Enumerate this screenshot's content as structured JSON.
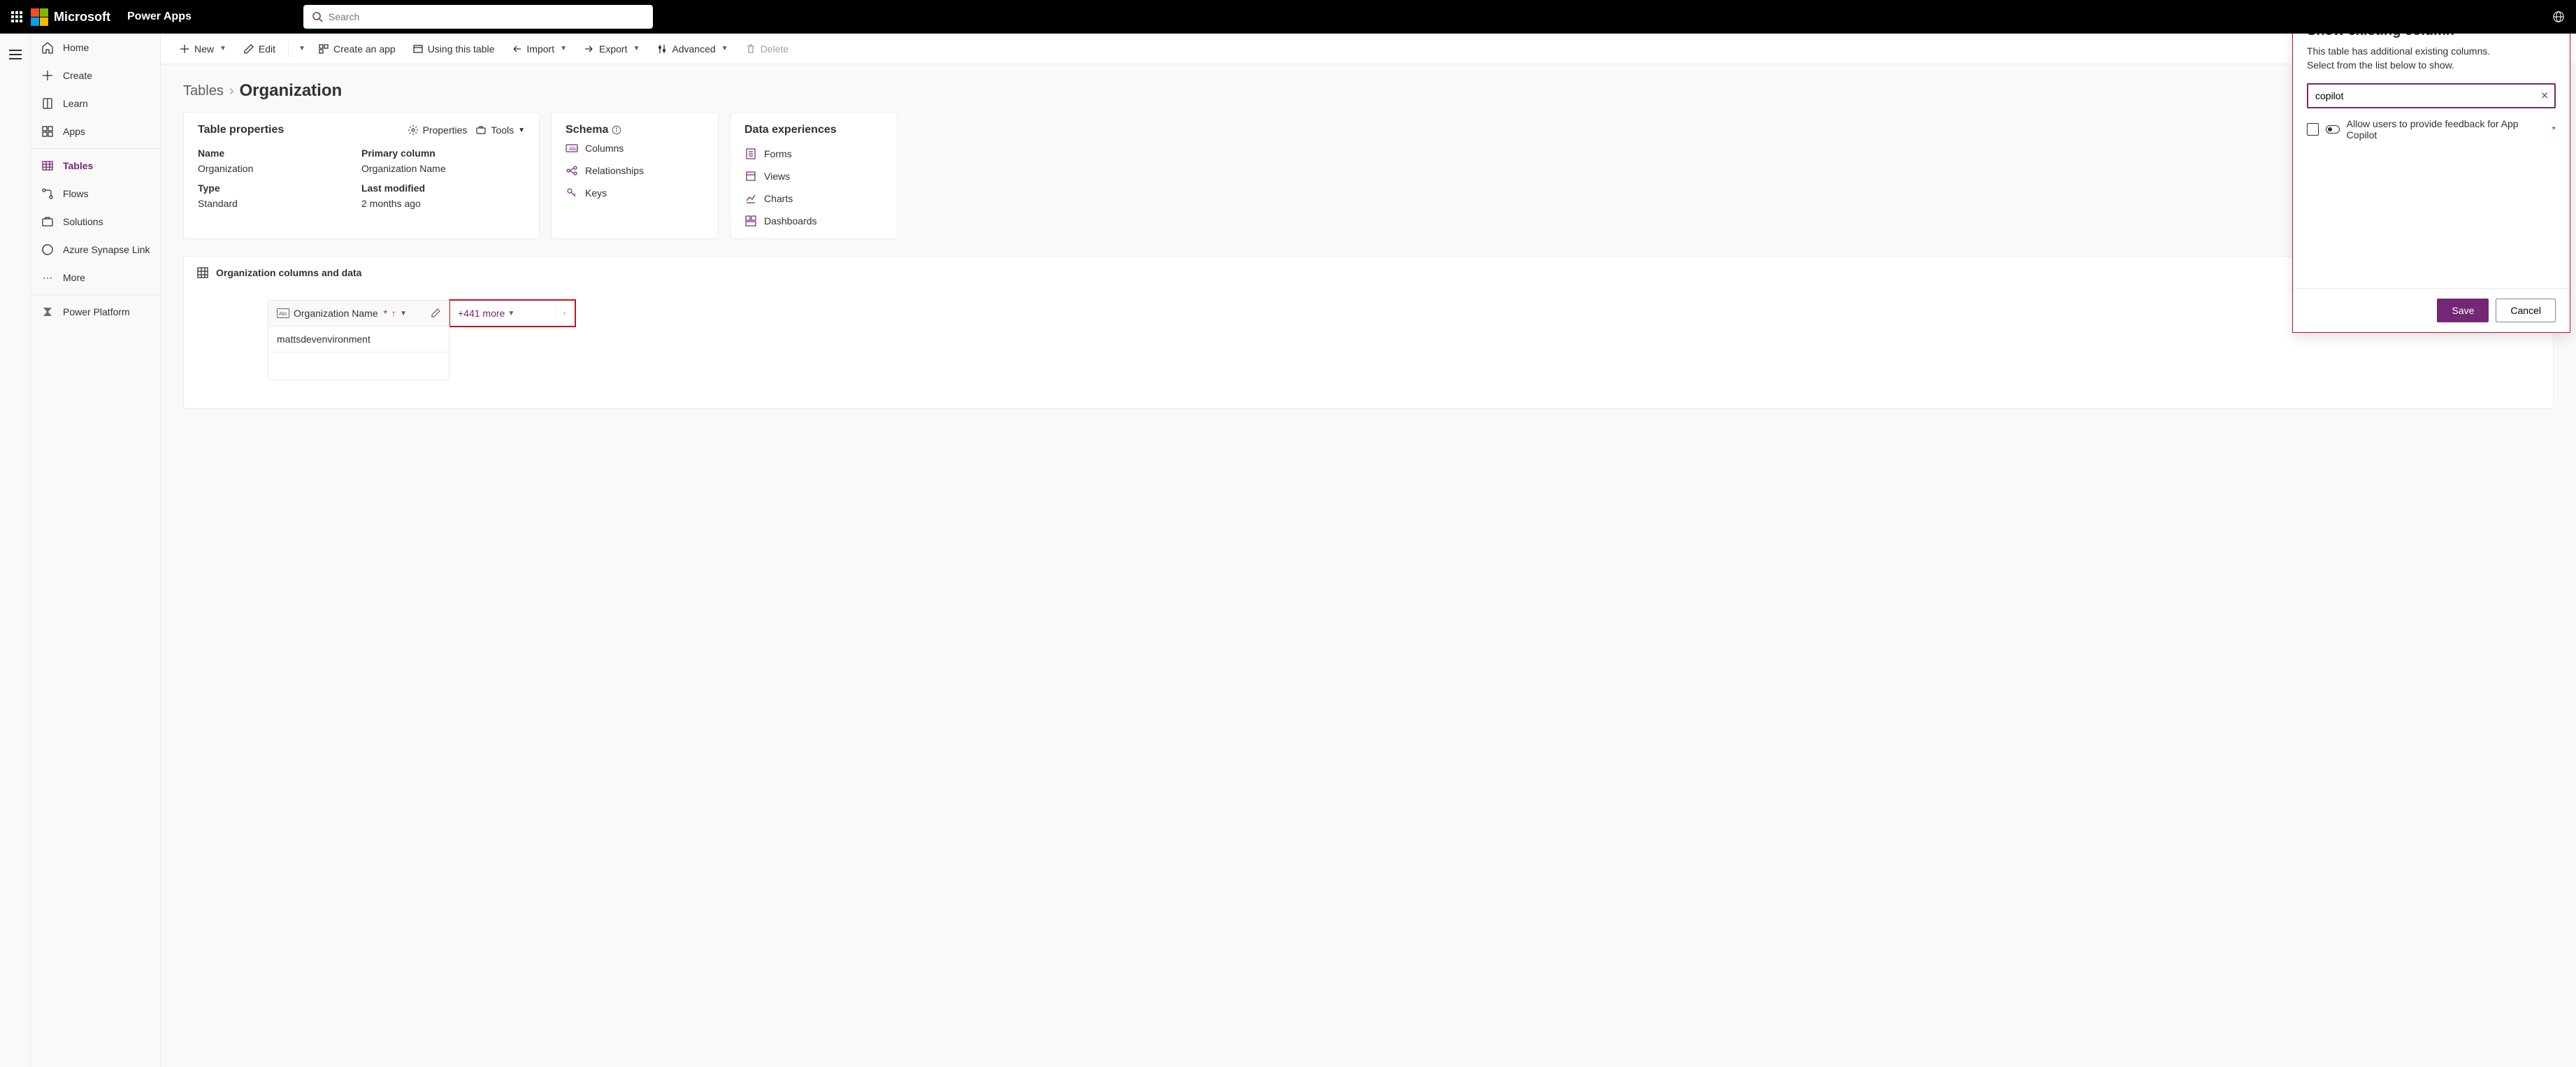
{
  "header": {
    "brand": "Microsoft",
    "app": "Power Apps",
    "search_placeholder": "Search"
  },
  "sidebar": {
    "items": [
      {
        "label": "Home"
      },
      {
        "label": "Create"
      },
      {
        "label": "Learn"
      },
      {
        "label": "Apps"
      },
      {
        "label": "Tables"
      },
      {
        "label": "Flows"
      },
      {
        "label": "Solutions"
      },
      {
        "label": "Azure Synapse Link"
      },
      {
        "label": "More"
      },
      {
        "label": "Power Platform"
      }
    ]
  },
  "commandbar": {
    "new": "New",
    "edit": "Edit",
    "create_app": "Create an app",
    "using_table": "Using this table",
    "import": "Import",
    "export": "Export",
    "advanced": "Advanced",
    "delete": "Delete"
  },
  "breadcrumb": {
    "root": "Tables",
    "current": "Organization"
  },
  "table_props": {
    "title": "Table properties",
    "properties_action": "Properties",
    "tools_action": "Tools",
    "name_label": "Name",
    "name_value": "Organization",
    "primary_label": "Primary column",
    "primary_value": "Organization Name",
    "type_label": "Type",
    "type_value": "Standard",
    "modified_label": "Last modified",
    "modified_value": "2 months ago"
  },
  "schema": {
    "title": "Schema",
    "columns": "Columns",
    "relationships": "Relationships",
    "keys": "Keys"
  },
  "data_exp": {
    "title": "Data experiences",
    "forms": "Forms",
    "views": "Views",
    "charts": "Charts",
    "dashboards": "Dashboards"
  },
  "columns_section": {
    "title": "Organization columns and data",
    "column_name": "Organization Name",
    "more": "+441 more",
    "row1": "mattsdevenvironment"
  },
  "panel": {
    "title": "Show existing column",
    "description1": "This table has additional existing columns.",
    "description2": "Select from the list below to show.",
    "search_value": "copilot",
    "result1": "Allow users to provide feedback for App Copilot",
    "save": "Save",
    "cancel": "Cancel"
  }
}
